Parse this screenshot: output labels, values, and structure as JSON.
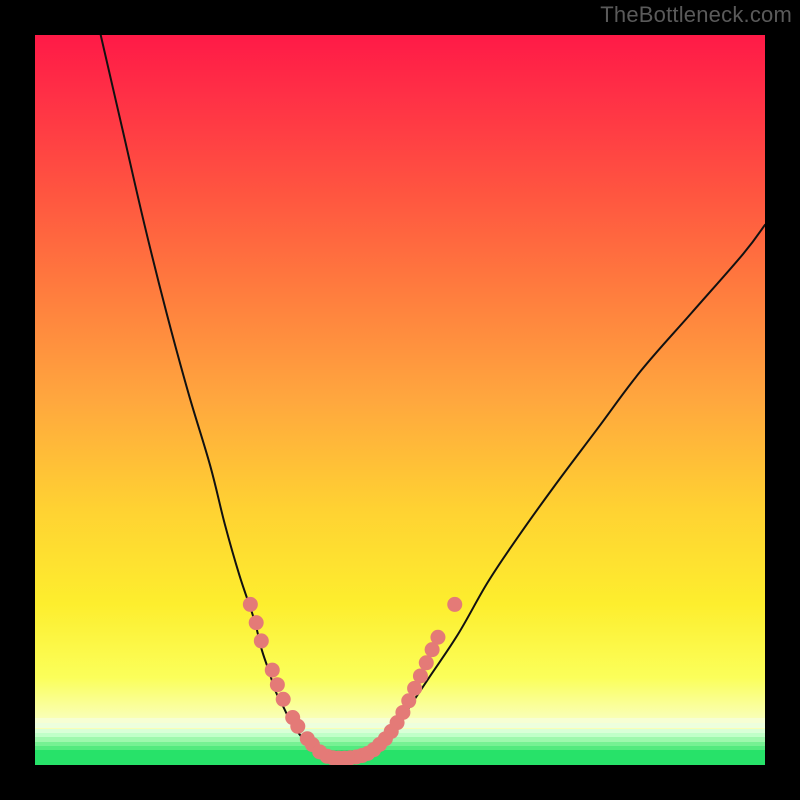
{
  "watermark": "TheBottleneck.com",
  "colors": {
    "frame_bg": "#000000",
    "curve_stroke": "#111111",
    "marker_fill": "#e47a77",
    "marker_stroke": "#d86a67",
    "green_base": "#27e269"
  },
  "chart_data": {
    "type": "line",
    "title": "",
    "xlabel": "",
    "ylabel": "",
    "xlim": [
      0,
      100
    ],
    "ylim": [
      0,
      100
    ],
    "grid": false,
    "legend_position": "none",
    "note": "Values are estimated from pixel positions; no axis labels present in image.",
    "series": [
      {
        "name": "left-branch",
        "x": [
          9,
          12,
          15,
          18,
          21,
          24,
          26,
          28,
          30,
          31,
          32,
          33,
          34,
          35,
          36,
          37,
          38,
          39
        ],
        "y": [
          100,
          87,
          74,
          62,
          51,
          41,
          33,
          26,
          20,
          16,
          13,
          10,
          8,
          6,
          4.5,
          3.3,
          2.3,
          1.4
        ]
      },
      {
        "name": "valley-floor",
        "x": [
          39,
          40,
          41,
          42,
          43,
          44,
          45
        ],
        "y": [
          1.4,
          1.0,
          0.9,
          0.9,
          0.9,
          1.0,
          1.2
        ]
      },
      {
        "name": "right-branch",
        "x": [
          45,
          47,
          49,
          51,
          54,
          58,
          62,
          66,
          71,
          77,
          83,
          90,
          97,
          100
        ],
        "y": [
          1.2,
          2.5,
          4.5,
          7.5,
          12,
          18,
          25,
          31,
          38,
          46,
          54,
          62,
          70,
          74
        ]
      }
    ],
    "markers": {
      "name": "highlighted-points",
      "points": [
        {
          "x": 29.5,
          "y": 22
        },
        {
          "x": 30.3,
          "y": 19.5
        },
        {
          "x": 31.0,
          "y": 17
        },
        {
          "x": 32.5,
          "y": 13
        },
        {
          "x": 33.2,
          "y": 11
        },
        {
          "x": 34.0,
          "y": 9
        },
        {
          "x": 35.3,
          "y": 6.5
        },
        {
          "x": 36.0,
          "y": 5.3
        },
        {
          "x": 37.3,
          "y": 3.6
        },
        {
          "x": 38.0,
          "y": 2.8
        },
        {
          "x": 39.0,
          "y": 1.8
        },
        {
          "x": 40.0,
          "y": 1.2
        },
        {
          "x": 40.8,
          "y": 1.0
        },
        {
          "x": 41.6,
          "y": 0.95
        },
        {
          "x": 42.4,
          "y": 0.95
        },
        {
          "x": 43.2,
          "y": 1.0
        },
        {
          "x": 44.0,
          "y": 1.1
        },
        {
          "x": 44.8,
          "y": 1.3
        },
        {
          "x": 45.6,
          "y": 1.6
        },
        {
          "x": 46.4,
          "y": 2.1
        },
        {
          "x": 47.2,
          "y": 2.8
        },
        {
          "x": 48.0,
          "y": 3.6
        },
        {
          "x": 48.8,
          "y": 4.6
        },
        {
          "x": 49.6,
          "y": 5.8
        },
        {
          "x": 50.4,
          "y": 7.2
        },
        {
          "x": 51.2,
          "y": 8.8
        },
        {
          "x": 52.0,
          "y": 10.5
        },
        {
          "x": 52.8,
          "y": 12.2
        },
        {
          "x": 53.6,
          "y": 14.0
        },
        {
          "x": 54.4,
          "y": 15.8
        },
        {
          "x": 55.2,
          "y": 17.5
        },
        {
          "x": 57.5,
          "y": 22.0
        }
      ]
    },
    "bottom_bands": [
      {
        "y": 6.5,
        "h": 0.8,
        "color": "#f6ffd3"
      },
      {
        "y": 5.7,
        "h": 0.7,
        "color": "#edffdd"
      },
      {
        "y": 5.0,
        "h": 0.6,
        "color": "#d9ffd7"
      },
      {
        "y": 4.4,
        "h": 0.6,
        "color": "#c0ffc8"
      },
      {
        "y": 3.8,
        "h": 0.6,
        "color": "#9ef8ad"
      },
      {
        "y": 3.2,
        "h": 0.6,
        "color": "#76f193"
      },
      {
        "y": 2.6,
        "h": 0.6,
        "color": "#54ea7f"
      },
      {
        "y": 2.0,
        "h": 2.0,
        "color": "#27e269"
      }
    ]
  }
}
